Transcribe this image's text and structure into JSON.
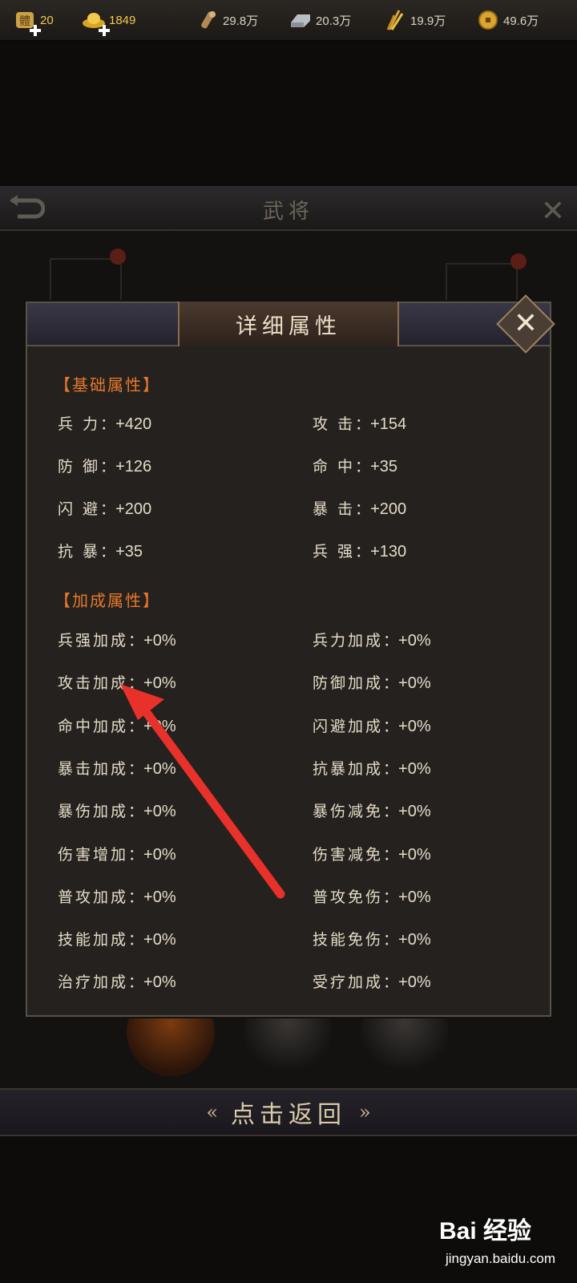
{
  "resources": [
    {
      "icon": "stamina-icon",
      "value": "20",
      "has_plus": true,
      "color": "#f2c94c"
    },
    {
      "icon": "gold-ingot-icon",
      "value": "1849",
      "has_plus": true,
      "color": "#f2c94c"
    },
    {
      "icon": "wood-icon",
      "value": "29.8万",
      "has_plus": false,
      "color": "#d9d2c4"
    },
    {
      "icon": "iron-icon",
      "value": "20.3万",
      "has_plus": false,
      "color": "#d9d2c4"
    },
    {
      "icon": "grain-icon",
      "value": "19.9万",
      "has_plus": false,
      "color": "#d9d2c4"
    },
    {
      "icon": "coin-icon",
      "value": "49.6万",
      "has_plus": false,
      "color": "#d9d2c4"
    }
  ],
  "background_screen": {
    "title": "武将"
  },
  "modal": {
    "title": "详细属性",
    "basic_section_title": "【基础属性】",
    "basic_attrs": [
      {
        "name": "兵 力",
        "value": "+420"
      },
      {
        "name": "攻 击",
        "value": "+154"
      },
      {
        "name": "防 御",
        "value": "+126"
      },
      {
        "name": "命 中",
        "value": "+35"
      },
      {
        "name": "闪 避",
        "value": "+200"
      },
      {
        "name": "暴 击",
        "value": "+200"
      },
      {
        "name": "抗 暴",
        "value": "+35"
      },
      {
        "name": "兵 强",
        "value": "+130"
      }
    ],
    "bonus_section_title": "【加成属性】",
    "bonus_attrs": [
      {
        "name": "兵强加成",
        "value": "+0%"
      },
      {
        "name": "兵力加成",
        "value": "+0%"
      },
      {
        "name": "攻击加成",
        "value": "+0%"
      },
      {
        "name": "防御加成",
        "value": "+0%"
      },
      {
        "name": "命中加成",
        "value": "+0%"
      },
      {
        "name": "闪避加成",
        "value": "+0%"
      },
      {
        "name": "暴击加成",
        "value": "+0%"
      },
      {
        "name": "抗暴加成",
        "value": "+0%"
      },
      {
        "name": "暴伤加成",
        "value": "+0%"
      },
      {
        "name": "暴伤减免",
        "value": "+0%"
      },
      {
        "name": "伤害增加",
        "value": "+0%"
      },
      {
        "name": "伤害减免",
        "value": "+0%"
      },
      {
        "name": "普攻加成",
        "value": "+0%"
      },
      {
        "name": "普攻免伤",
        "value": "+0%"
      },
      {
        "name": "技能加成",
        "value": "+0%"
      },
      {
        "name": "技能免伤",
        "value": "+0%"
      },
      {
        "name": "治疗加成",
        "value": "+0%"
      },
      {
        "name": "受疗加成",
        "value": "+0%"
      }
    ],
    "colon": "："
  },
  "return_button": {
    "label": "点击返回",
    "left_arrow": "«",
    "right_arrow": "»"
  },
  "watermark": {
    "main": "Bai 经验",
    "sub": "jingyan.baidu.com"
  },
  "colors": {
    "section_title": "#e8782b",
    "annotation_arrow": "#e8312a"
  }
}
